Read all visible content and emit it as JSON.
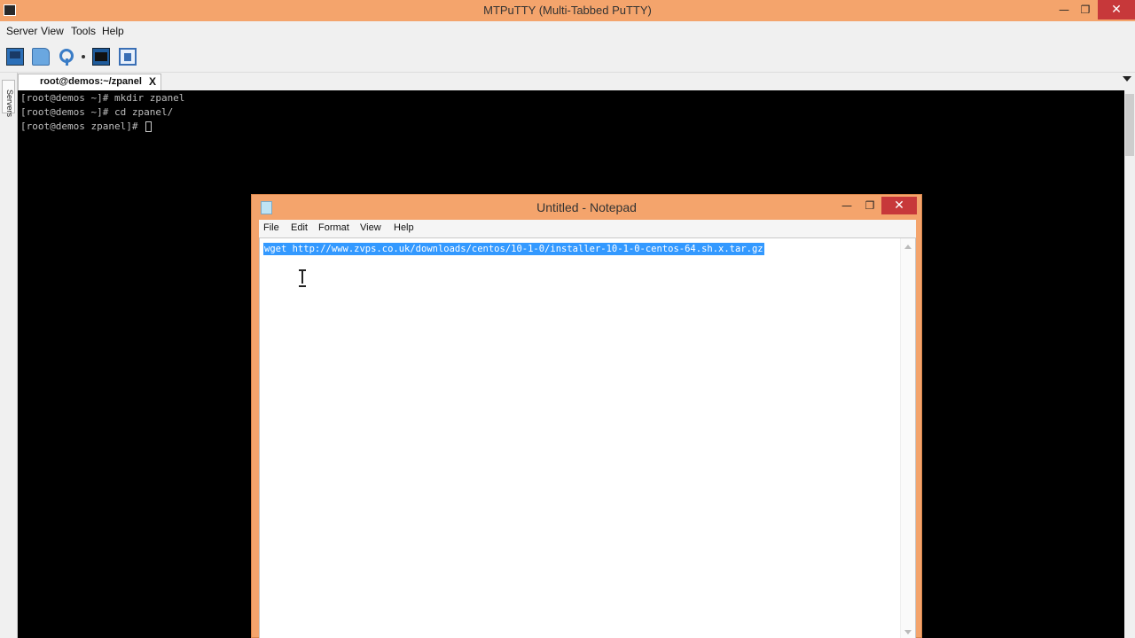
{
  "window": {
    "title": "MTPuTTY (Multi-Tabbed PuTTY)",
    "minimize": "—",
    "maximize": "❐",
    "close": "✕"
  },
  "menubar": {
    "items": [
      "Server",
      "View",
      "Tools",
      "Help"
    ]
  },
  "toolbar": {
    "icons": [
      "connect-icon",
      "open-folder-icon",
      "find-icon",
      "terminal-icon",
      "document-icon"
    ]
  },
  "tabs": [
    {
      "label": "root@demos:~/zpanel",
      "close": "X"
    }
  ],
  "servers_panel": {
    "label": "Servers"
  },
  "terminal": {
    "lines": [
      "[root@demos ~]# mkdir zpanel",
      "[root@demos ~]# cd zpanel/",
      "[root@demos zpanel]# "
    ]
  },
  "notepad": {
    "title": "Untitled - Notepad",
    "minimize": "—",
    "maximize": "❐",
    "close": "✕",
    "menu": [
      "File",
      "Edit",
      "Format",
      "View",
      "Help"
    ],
    "content": "wget http://www.zvps.co.uk/downloads/centos/10-1-0/installer-10-1-0-centos-64.sh.x.tar.gz"
  },
  "colors": {
    "titlebar": "#f4a46c",
    "close_button": "#c7383a",
    "selection": "#3399ff"
  }
}
